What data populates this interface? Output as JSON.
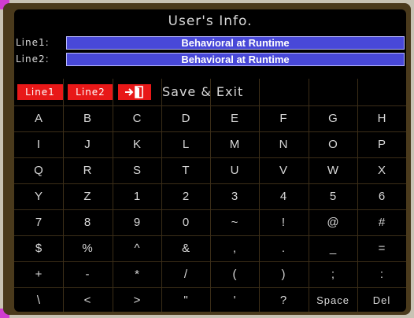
{
  "title": "User's Info.",
  "lines": [
    {
      "label": "Line1:",
      "value": "Behavioral at Runtime"
    },
    {
      "label": "Line2:",
      "value": "Behavioral at Runtime"
    }
  ],
  "toolbar": {
    "line1_label": "Line1",
    "line2_label": "Line2",
    "exit_icon": "exit-door-icon",
    "save_exit_label": "Save & Exit"
  },
  "keys": [
    [
      "A",
      "B",
      "C",
      "D",
      "E",
      "F",
      "G",
      "H"
    ],
    [
      "I",
      "J",
      "K",
      "L",
      "M",
      "N",
      "O",
      "P"
    ],
    [
      "Q",
      "R",
      "S",
      "T",
      "U",
      "V",
      "W",
      "X"
    ],
    [
      "Y",
      "Z",
      "1",
      "2",
      "3",
      "4",
      "5",
      "6"
    ],
    [
      "7",
      "8",
      "9",
      "0",
      "~",
      "!",
      "@",
      "#"
    ],
    [
      "$",
      "%",
      "^",
      "&",
      ",",
      ".",
      "_",
      "="
    ],
    [
      "+",
      "-",
      "*",
      "/",
      "(",
      ")",
      ";",
      ":"
    ],
    [
      "\\",
      "<",
      ">",
      "\"",
      "'",
      "?",
      "Space",
      "Del"
    ]
  ],
  "colors": {
    "screen_bg": "#000000",
    "frame": "#4a3a1c",
    "field_bg": "#4848d8",
    "button_red": "#e81818",
    "grid": "#3c2e18"
  }
}
